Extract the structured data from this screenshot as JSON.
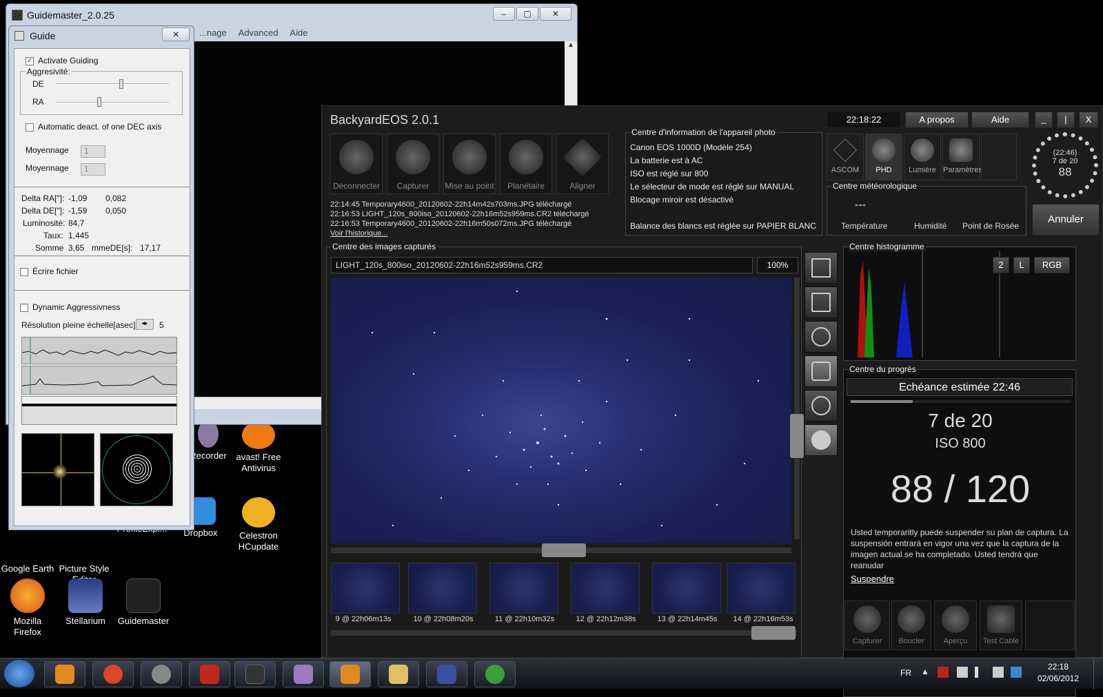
{
  "desktop_icons": [
    {
      "label": "Google Earth",
      "color": "#2a6bd8"
    },
    {
      "label": "Picture Style Editor",
      "color": "#cfcfcf"
    },
    {
      "label": "ProfileExpl...",
      "color": "#7a6aa0"
    },
    {
      "label": "Dropbox",
      "color": "#2f8de0"
    },
    {
      "label": "Celestron HCupdate",
      "color": "#f0b020"
    },
    {
      "label": "Mozilla Firefox",
      "color": "#e86a1a"
    },
    {
      "label": "Stellarium",
      "color": "#3a4fa0"
    },
    {
      "label": "Guidemaster",
      "color": "#333333"
    },
    {
      "label": "Recorder",
      "color": "#8a7aa0"
    },
    {
      "label": "avast! Free Antivirus",
      "color": "#f07a10"
    }
  ],
  "guidemaster": {
    "title": "Guidemaster_2.0.25",
    "menu": [
      "...nage",
      "Advanced",
      "Aide"
    ],
    "btn_min": "–",
    "btn_max": "▢",
    "btn_close": "✕"
  },
  "guide": {
    "title": "Guide",
    "close": "✕",
    "activate_guiding": "Activate Guiding",
    "aggressivite": "Aggresivité:",
    "de": "DE",
    "ra": "RA",
    "auto_deact": "Automatic deact. of one DEC axis",
    "moyennage1": "Moyennage",
    "moyennage2": "Moyennage",
    "spin_value": "1",
    "delta_ra_label": "Delta RA[\"]:",
    "delta_ra_v1": "-1,09",
    "delta_ra_v2": "0,082",
    "delta_de_label": "Delta DE[\"]:",
    "delta_de_v1": "-1,59",
    "delta_de_v2": "0,050",
    "lum_label": "Luminosité:",
    "lum_value": "84,7",
    "taux_label": "Taux:",
    "taux_value": "1,445",
    "somme_label": "Somme",
    "somme_value": "3,65",
    "somme_de_label": "mmeDE[s]:",
    "somme_de_value": "17,17",
    "ecrire": "Écrire fichier",
    "dynamic": "Dynamic Aggressivness",
    "resolution": "Résolution pleine échelle[asec]:",
    "resolution_value": "5"
  },
  "backyard": {
    "title": "BackyardEOS 2.0.1",
    "clock": "22:18:22",
    "apropos": "A propos",
    "aide": "Aide",
    "win_min": "_",
    "win_max": "|",
    "win_close": "X",
    "tools": [
      "Déconnecter",
      "Capturer",
      "Mise au point",
      "Planétaire",
      "Aligner"
    ],
    "log": [
      "22:14:45  Temporary4600_20120602-22h14m42s703ms.JPG téléchargé",
      "22:16:53  LIGHT_120s_800iso_20120602-22h16m52s959ms.CR2 téléchargé",
      "22:16:53  Temporary4600_20120602-22h16m50s072ms.JPG téléchargé"
    ],
    "history_link": "Voir l'historique...",
    "camera_info": {
      "title": "Centre d'information de l'appareil photo",
      "lines": [
        "Canon EOS 1000D   (Modèle 254)",
        "La batterie est à AC",
        "ISO est réglé sur 800",
        "Le sélecteur de mode est réglé sur MANUAL",
        "Blocage miroir est désactivé",
        "",
        "Balance des blancs est réglée sur PAPIER BLANC"
      ]
    },
    "right_tools": [
      "ASCOM",
      "PHD",
      "Lumière",
      "Paramètres"
    ],
    "dial": {
      "time": "(22:46)",
      "progress": "7 de 20",
      "value": "88"
    },
    "annuler": "Annuler",
    "weather": {
      "title": "Centre météorologique",
      "temp_value": "---",
      "temp": "Température",
      "hum": "Humidité",
      "dew": "Point de Rosée"
    },
    "images": {
      "title": "Centre des images capturés",
      "filename": "LIGHT_120s_800iso_20120602-22h16m52s959ms.CR2",
      "zoom": "100%"
    },
    "histogram": {
      "title": "Centre histogramme",
      "btn2": "2",
      "btnL": "L",
      "btnRGB": "RGB"
    },
    "progress": {
      "title": "Centre du progrès",
      "eta": "Echéance estimée 22:46",
      "count": "7 de 20",
      "iso": "ISO 800",
      "frames": "88 / 120",
      "bar_fraction": 0.28,
      "note": "Usted temporaritly puede suspender su plan de captura. La suspensión entrará en vigor una vez que la captura de la imagen actual se ha completado. Usted tendrá que reanudar",
      "suspend": "Suspendre"
    },
    "thumbs": [
      "9 @ 22h06m13s",
      "10 @ 22h08m20s",
      "11 @ 22h10m32s",
      "12 @ 22h12m38s",
      "13 @ 22h14m45s",
      "14 @ 22h16m53s"
    ],
    "bottom_tools": [
      "Capturer",
      "Boucler",
      "Aperçu",
      "Test Cable"
    ]
  },
  "taskbar": {
    "lang": "FR",
    "time": "22:18",
    "date": "02/06/2012",
    "apps": [
      {
        "name": "media-player",
        "color": "#e08a20"
      },
      {
        "name": "chrome",
        "color": "#d9452e"
      },
      {
        "name": "sphere",
        "color": "#888888"
      },
      {
        "name": "red-tool",
        "color": "#c0281c"
      },
      {
        "name": "guidemaster",
        "color": "#333333"
      },
      {
        "name": "profile",
        "color": "#9a7ac0"
      },
      {
        "name": "backyardeos",
        "color": "#e08a20"
      },
      {
        "name": "explorer",
        "color": "#e0c060"
      },
      {
        "name": "stellarium",
        "color": "#3a4fa0"
      },
      {
        "name": "utorrent",
        "color": "#3aa03a"
      }
    ]
  }
}
